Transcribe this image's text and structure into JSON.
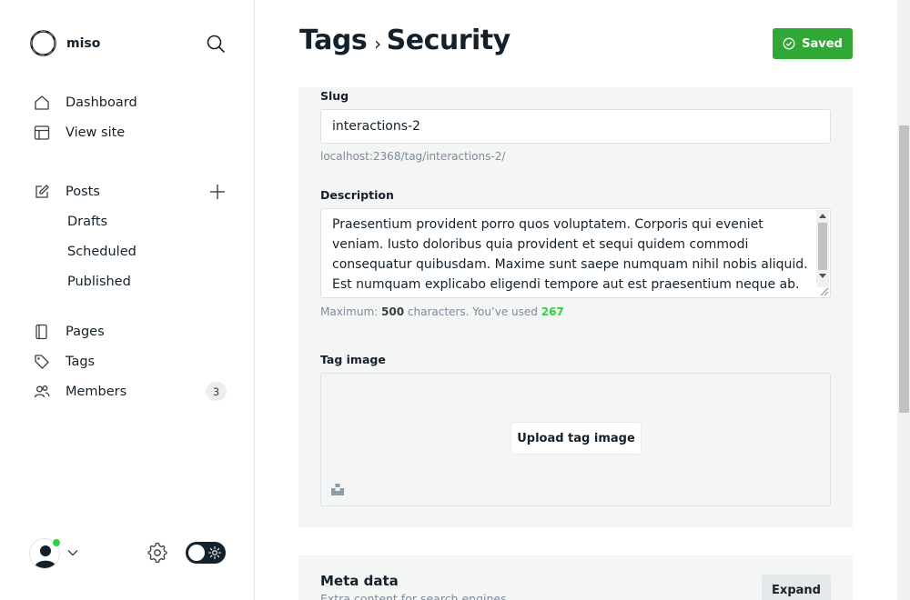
{
  "app": {
    "brand_name": "miso"
  },
  "sidebar": {
    "nav_top": [
      {
        "label": "Dashboard",
        "icon": "home-icon"
      },
      {
        "label": "View site",
        "icon": "layout-icon"
      }
    ],
    "posts": {
      "label": "Posts",
      "icon": "edit-icon",
      "subitems": [
        "Drafts",
        "Scheduled",
        "Published"
      ]
    },
    "nav_bottom": [
      {
        "label": "Pages",
        "icon": "page-icon"
      },
      {
        "label": "Tags",
        "icon": "tag-icon"
      },
      {
        "label": "Members",
        "icon": "members-icon",
        "badge": "3"
      }
    ]
  },
  "header": {
    "breadcrumb_parent": "Tags",
    "breadcrumb_separator": "›",
    "breadcrumb_current": "Security",
    "saved_label": "Saved"
  },
  "form": {
    "slug_label": "Slug",
    "slug_value": "interactions-2",
    "slug_url": "localhost:2368/tag/interactions-2/",
    "description_label": "Description",
    "description_value": "Praesentium provident porro quos voluptatem. Corporis qui eveniet veniam. Iusto doloribus quia provident et sequi quidem commodi consequatur quibusdam. Maxime sunt saepe numquam nihil nobis aliquid. Est numquam explicabo eligendi tempore aut est praesentium neque ab.",
    "char_hint_prefix": "Maximum:",
    "char_max": "500",
    "char_hint_middle": "characters. You’ve used",
    "char_used": "267",
    "tag_image_label": "Tag image",
    "upload_label": "Upload tag image"
  },
  "meta": {
    "title": "Meta data",
    "subtitle": "Extra content for search engines",
    "expand_label": "Expand"
  },
  "colors": {
    "accent_green": "#30a835",
    "count_green": "#30cf43",
    "ink": "#15212a",
    "panel_bg": "#f4f5f5"
  }
}
